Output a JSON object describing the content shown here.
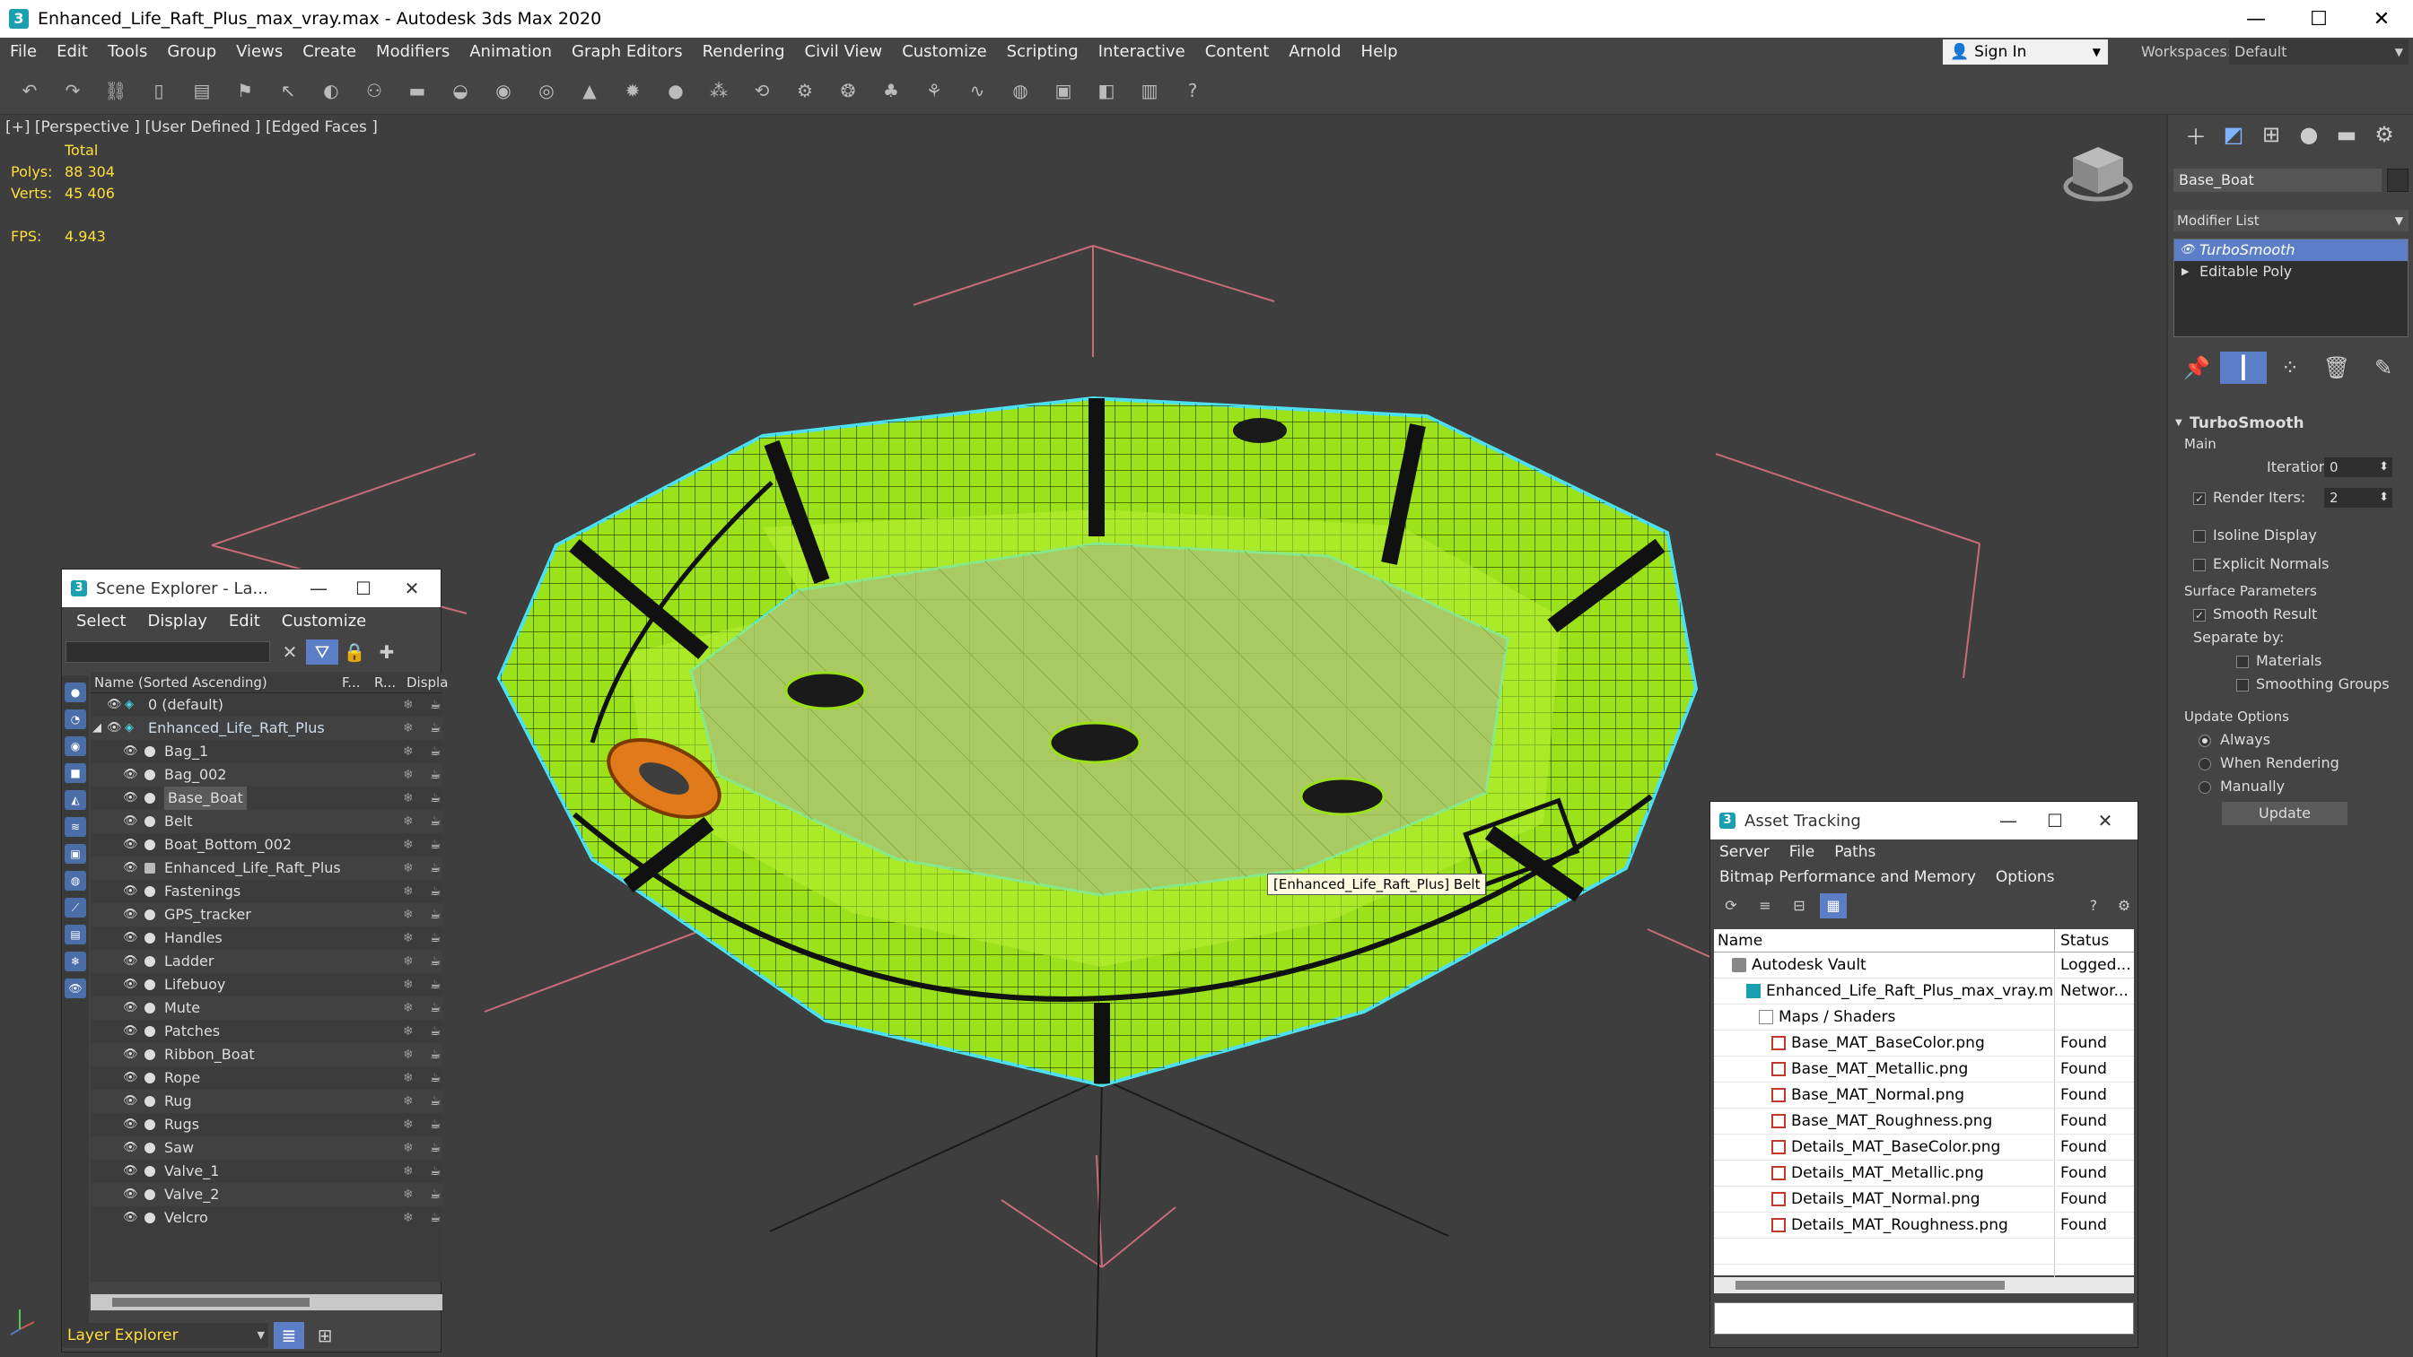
{
  "window": {
    "title": "Enhanced_Life_Raft_Plus_max_vray.max - Autodesk 3ds Max 2020",
    "minimize": "—",
    "maximize": "☐",
    "close": "✕"
  },
  "menubar": {
    "items": [
      "File",
      "Edit",
      "Tools",
      "Group",
      "Views",
      "Create",
      "Modifiers",
      "Animation",
      "Graph Editors",
      "Rendering",
      "Civil View",
      "Customize",
      "Scripting",
      "Interactive",
      "Content",
      "Arnold",
      "Help"
    ],
    "sign_in": "Sign In",
    "workspaces_label": "Workspaces:",
    "workspace_value": "Default"
  },
  "viewport": {
    "label": "[+] [Perspective ] [User Defined ] [Edged Faces ]",
    "stats": {
      "total_label": "Total",
      "polys_label": "Polys:",
      "polys_value": "88 304",
      "verts_label": "Verts:",
      "verts_value": "45 406",
      "fps_label": "FPS:",
      "fps_value": "4.943"
    },
    "tooltip": "[Enhanced_Life_Raft_Plus] Belt"
  },
  "command_panel": {
    "object_name": "Base_Boat",
    "modifier_list": "Modifier List",
    "stack": [
      "TurboSmooth",
      "Editable Poly"
    ],
    "turbosmooth": {
      "title": "TurboSmooth",
      "main": "Main",
      "iterations_label": "Iterations:",
      "iterations_value": "0",
      "render_iters_label": "Render Iters:",
      "render_iters_value": "2",
      "isoline_display": "Isoline Display",
      "explicit_normals": "Explicit Normals",
      "surface_parameters": "Surface Parameters",
      "smooth_result": "Smooth Result",
      "separate_by": "Separate by:",
      "materials": "Materials",
      "smoothing_groups": "Smoothing Groups",
      "update_options": "Update Options",
      "always": "Always",
      "when_rendering": "When Rendering",
      "manually": "Manually",
      "update_button": "Update"
    }
  },
  "scene_explorer": {
    "title": "Scene Explorer - La...",
    "menu": [
      "Select",
      "Display",
      "Edit",
      "Customize"
    ],
    "columns": {
      "name": "Name (Sorted Ascending)",
      "f": "F...",
      "r": "R...",
      "display": "Displa"
    },
    "rows": [
      {
        "name": "0 (default)",
        "level": 0,
        "type": "layer"
      },
      {
        "name": "Enhanced_Life_Raft_Plus",
        "level": 0,
        "type": "layer"
      },
      {
        "name": "Bag_1",
        "level": 1,
        "type": "object"
      },
      {
        "name": "Bag_002",
        "level": 1,
        "type": "object"
      },
      {
        "name": "Base_Boat",
        "level": 1,
        "type": "object"
      },
      {
        "name": "Belt",
        "level": 1,
        "type": "object"
      },
      {
        "name": "Boat_Bottom_002",
        "level": 1,
        "type": "object"
      },
      {
        "name": "Enhanced_Life_Raft_Plus",
        "level": 1,
        "type": "group"
      },
      {
        "name": "Fastenings",
        "level": 1,
        "type": "object"
      },
      {
        "name": "GPS_tracker",
        "level": 1,
        "type": "object"
      },
      {
        "name": "Handles",
        "level": 1,
        "type": "object"
      },
      {
        "name": "Ladder",
        "level": 1,
        "type": "object"
      },
      {
        "name": "Lifebuoy",
        "level": 1,
        "type": "object"
      },
      {
        "name": "Mute",
        "level": 1,
        "type": "object"
      },
      {
        "name": "Patches",
        "level": 1,
        "type": "object"
      },
      {
        "name": "Ribbon_Boat",
        "level": 1,
        "type": "object"
      },
      {
        "name": "Rope",
        "level": 1,
        "type": "object"
      },
      {
        "name": "Rug",
        "level": 1,
        "type": "object"
      },
      {
        "name": "Rugs",
        "level": 1,
        "type": "object"
      },
      {
        "name": "Saw",
        "level": 1,
        "type": "object"
      },
      {
        "name": "Valve_1",
        "level": 1,
        "type": "object"
      },
      {
        "name": "Valve_2",
        "level": 1,
        "type": "object"
      },
      {
        "name": "Velcro",
        "level": 1,
        "type": "object"
      }
    ],
    "layer_explorer": "Layer Explorer"
  },
  "asset_tracking": {
    "title": "Asset Tracking",
    "menu1": [
      "Server",
      "File",
      "Paths"
    ],
    "menu2": [
      "Bitmap Performance and Memory",
      "Options"
    ],
    "columns": {
      "name": "Name",
      "status": "Status"
    },
    "rows": [
      {
        "name": "Autodesk Vault",
        "status": "Logged...",
        "icon": "vault",
        "indent": 0
      },
      {
        "name": "Enhanced_Life_Raft_Plus_max_vray.max",
        "status": "Networ...",
        "icon": "max",
        "indent": 1
      },
      {
        "name": "Maps / Shaders",
        "status": "",
        "icon": "folder",
        "indent": 2
      },
      {
        "name": "Base_MAT_BaseColor.png",
        "status": "Found",
        "icon": "img",
        "indent": 3
      },
      {
        "name": "Base_MAT_Metallic.png",
        "status": "Found",
        "icon": "img",
        "indent": 3
      },
      {
        "name": "Base_MAT_Normal.png",
        "status": "Found",
        "icon": "img",
        "indent": 3
      },
      {
        "name": "Base_MAT_Roughness.png",
        "status": "Found",
        "icon": "img",
        "indent": 3
      },
      {
        "name": "Details_MAT_BaseColor.png",
        "status": "Found",
        "icon": "img",
        "indent": 3
      },
      {
        "name": "Details_MAT_Metallic.png",
        "status": "Found",
        "icon": "img",
        "indent": 3
      },
      {
        "name": "Details_MAT_Normal.png",
        "status": "Found",
        "icon": "img",
        "indent": 3
      },
      {
        "name": "Details_MAT_Roughness.png",
        "status": "Found",
        "icon": "img",
        "indent": 3
      }
    ]
  },
  "colors": {
    "raft_green": "#a8f01e",
    "selection_blue": "#5b7ec7",
    "stats_yellow": "#ffdf3a",
    "outline_cyan": "#4de0f0"
  }
}
